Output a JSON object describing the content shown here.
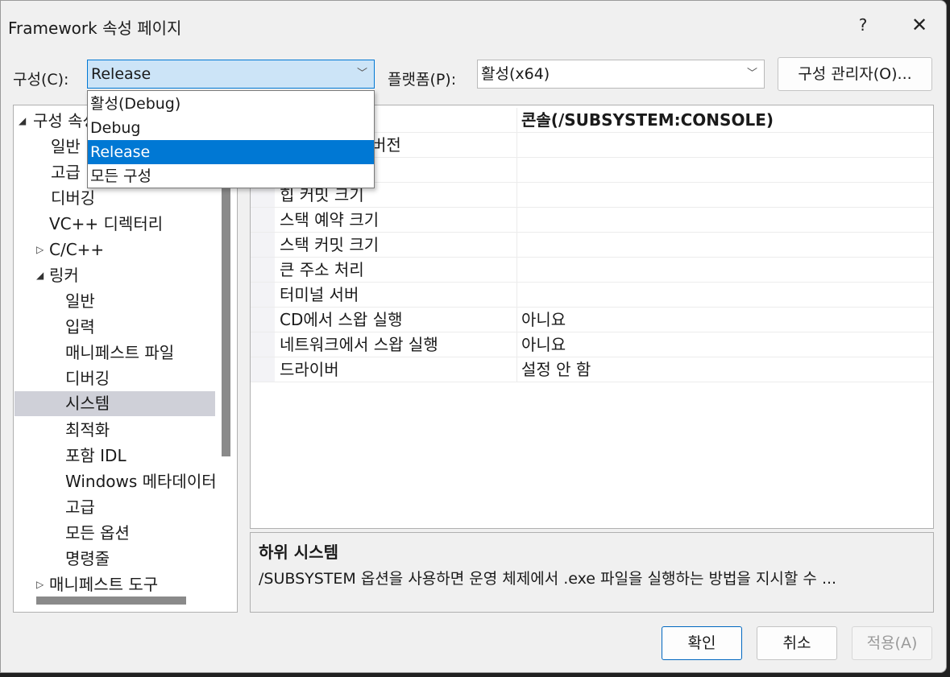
{
  "window": {
    "title": "Framework 속성 페이지",
    "help": "?",
    "close": "✕"
  },
  "config": {
    "label": "구성(C):",
    "value": "Release",
    "options": [
      "활성(Debug)",
      "Debug",
      "Release",
      "모든 구성"
    ],
    "selected_option": "Release"
  },
  "platform": {
    "label": "플랫폼(P):",
    "value": "활성(x64)"
  },
  "config_manager_label": "구성 관리자(O)...",
  "tree": {
    "items": [
      {
        "label": "구성 속성",
        "expander": "◢"
      },
      {
        "label": "일반"
      },
      {
        "label": "고급"
      },
      {
        "label": "디버깅"
      },
      {
        "label": "VC++ 디렉터리"
      },
      {
        "label": "C/C++",
        "expander": "▷"
      },
      {
        "label": "링커",
        "expander": "◢"
      },
      {
        "label": "일반"
      },
      {
        "label": "입력"
      },
      {
        "label": "매니페스트 파일"
      },
      {
        "label": "디버깅"
      },
      {
        "label": "시스템"
      },
      {
        "label": "최적화"
      },
      {
        "label": "포함 IDL"
      },
      {
        "label": "Windows 메타데이터"
      },
      {
        "label": "고급"
      },
      {
        "label": "모든 옵션"
      },
      {
        "label": "명령줄"
      },
      {
        "label": "매니페스트 도구",
        "expander": "▷"
      }
    ],
    "selected": "시스템"
  },
  "grid": {
    "rows": [
      {
        "name": "",
        "value": "콘솔(/SUBSYSTEM:CONSOLE)"
      },
      {
        "name": "버전",
        "value": ""
      },
      {
        "name": "",
        "value": ""
      },
      {
        "name": "힙 커밋 크기",
        "value": ""
      },
      {
        "name": "스택 예약 크기",
        "value": ""
      },
      {
        "name": "스택 커밋 크기",
        "value": ""
      },
      {
        "name": "큰 주소 처리",
        "value": ""
      },
      {
        "name": "터미널 서버",
        "value": ""
      },
      {
        "name": "CD에서 스왑 실행",
        "value": "아니요"
      },
      {
        "name": "네트워크에서 스왑 실행",
        "value": "아니요"
      },
      {
        "name": "드라이버",
        "value": "설정 안 함"
      }
    ]
  },
  "description": {
    "title": "하위 시스템",
    "text": "/SUBSYSTEM 옵션을 사용하면 운영 체제에서 .exe 파일을 실행하는 방법을 지시할 수 ..."
  },
  "buttons": {
    "ok": "확인",
    "cancel": "취소",
    "apply": "적용(A)"
  },
  "icons": {
    "chevron": "﹀"
  }
}
